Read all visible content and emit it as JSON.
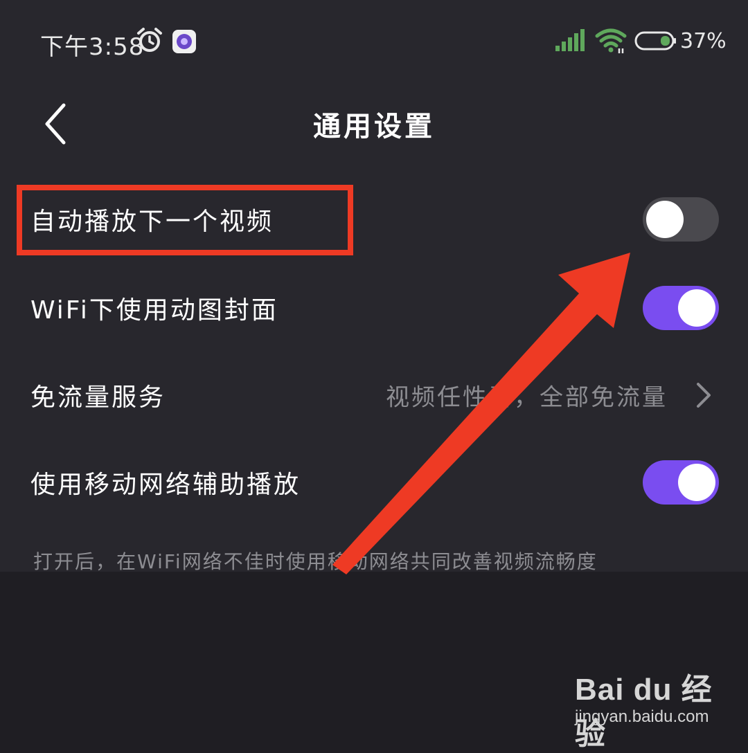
{
  "status_bar": {
    "time": "下午3:58",
    "battery": "37%",
    "icons": [
      "alarm-icon",
      "app-icon",
      "signal-icon",
      "wifi-icon",
      "battery-icon"
    ]
  },
  "header": {
    "title": "通用设置",
    "back_icon": "chevron-left-icon"
  },
  "settings": [
    {
      "label": "自动播放下一个视频",
      "control": "toggle",
      "on": false
    },
    {
      "label": "WiFi下使用动图封面",
      "control": "toggle",
      "on": true
    },
    {
      "label": "免流量服务",
      "control": "link",
      "value": "视频任性看，全部免流量"
    },
    {
      "label": "使用移动网络辅助播放",
      "control": "toggle",
      "on": true
    }
  ],
  "hint": "打开后，在WiFi网络不佳时使用移动网络共同改善视频流畅度",
  "colors": {
    "accent": "#7a4df0",
    "toggle_off": "#4a494e",
    "annotation": "#ee3a24",
    "background": "#28272d"
  },
  "watermark": {
    "logo": "Bai du 经验",
    "url": "jingyan.baidu.com"
  }
}
